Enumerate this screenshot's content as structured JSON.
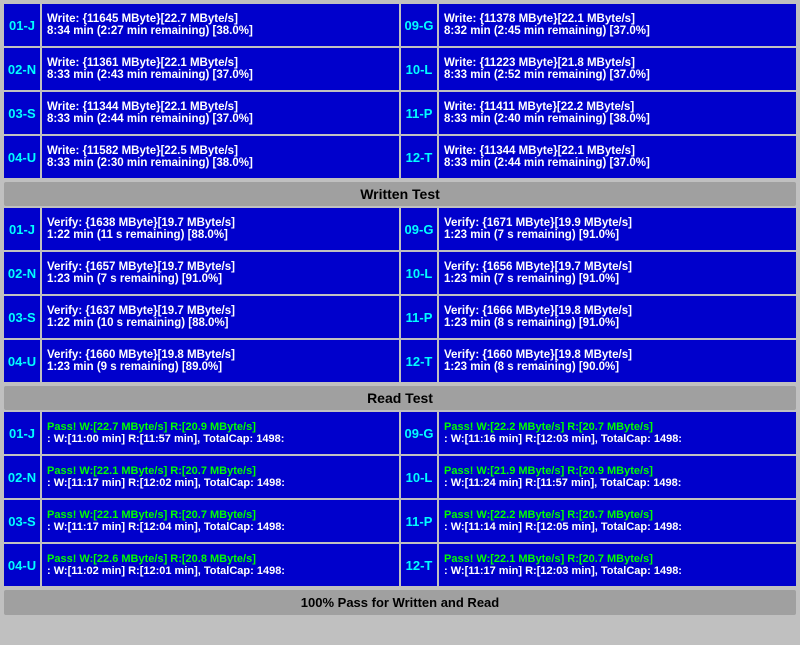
{
  "sections": {
    "write": {
      "label": "Written Test",
      "rows": [
        {
          "left": {
            "id": "01-J",
            "line1": "Write: {11645 MByte}[22.7 MByte/s]",
            "line2": "8:34 min (2:27 min remaining)  [38.0%]"
          },
          "right": {
            "id": "09-G",
            "line1": "Write: {11378 MByte}[22.1 MByte/s]",
            "line2": "8:32 min (2:45 min remaining)  [37.0%]"
          }
        },
        {
          "left": {
            "id": "02-N",
            "line1": "Write: {11361 MByte}[22.1 MByte/s]",
            "line2": "8:33 min (2:43 min remaining)  [37.0%]"
          },
          "right": {
            "id": "10-L",
            "line1": "Write: {11223 MByte}[21.8 MByte/s]",
            "line2": "8:33 min (2:52 min remaining)  [37.0%]"
          }
        },
        {
          "left": {
            "id": "03-S",
            "line1": "Write: {11344 MByte}[22.1 MByte/s]",
            "line2": "8:33 min (2:44 min remaining)  [37.0%]"
          },
          "right": {
            "id": "11-P",
            "line1": "Write: {11411 MByte}[22.2 MByte/s]",
            "line2": "8:33 min (2:40 min remaining)  [38.0%]"
          }
        },
        {
          "left": {
            "id": "04-U",
            "line1": "Write: {11582 MByte}[22.5 MByte/s]",
            "line2": "8:33 min (2:30 min remaining)  [38.0%]"
          },
          "right": {
            "id": "12-T",
            "line1": "Write: {11344 MByte}[22.1 MByte/s]",
            "line2": "8:33 min (2:44 min remaining)  [37.0%]"
          }
        }
      ]
    },
    "verify": {
      "label": "Written Test",
      "rows": [
        {
          "left": {
            "id": "01-J",
            "line1": "Verify: {1638 MByte}[19.7 MByte/s]",
            "line2": "1:22 min (11 s remaining)   [88.0%]"
          },
          "right": {
            "id": "09-G",
            "line1": "Verify: {1671 MByte}[19.9 MByte/s]",
            "line2": "1:23 min (7 s remaining)   [91.0%]"
          }
        },
        {
          "left": {
            "id": "02-N",
            "line1": "Verify: {1657 MByte}[19.7 MByte/s]",
            "line2": "1:23 min (7 s remaining)   [91.0%]"
          },
          "right": {
            "id": "10-L",
            "line1": "Verify: {1656 MByte}[19.7 MByte/s]",
            "line2": "1:23 min (7 s remaining)   [91.0%]"
          }
        },
        {
          "left": {
            "id": "03-S",
            "line1": "Verify: {1637 MByte}[19.7 MByte/s]",
            "line2": "1:22 min (10 s remaining)   [88.0%]"
          },
          "right": {
            "id": "11-P",
            "line1": "Verify: {1666 MByte}[19.8 MByte/s]",
            "line2": "1:23 min (8 s remaining)   [91.0%]"
          }
        },
        {
          "left": {
            "id": "04-U",
            "line1": "Verify: {1660 MByte}[19.8 MByte/s]",
            "line2": "1:23 min (9 s remaining)   [89.0%]"
          },
          "right": {
            "id": "12-T",
            "line1": "Verify: {1660 MByte}[19.8 MByte/s]",
            "line2": "1:23 min (8 s remaining)   [90.0%]"
          }
        }
      ]
    },
    "read": {
      "label": "Read Test",
      "rows": [
        {
          "left": {
            "id": "01-J",
            "line1": "Pass! W:[22.7 MByte/s] R:[20.9 MByte/s]",
            "line2": ": W:[11:00 min] R:[11:57 min], TotalCap: 1498:"
          },
          "right": {
            "id": "09-G",
            "line1": "Pass! W:[22.2 MByte/s] R:[20.7 MByte/s]",
            "line2": ": W:[11:16 min] R:[12:03 min], TotalCap: 1498:"
          }
        },
        {
          "left": {
            "id": "02-N",
            "line1": "Pass! W:[22.1 MByte/s] R:[20.7 MByte/s]",
            "line2": ": W:[11:17 min] R:[12:02 min], TotalCap: 1498:"
          },
          "right": {
            "id": "10-L",
            "line1": "Pass! W:[21.9 MByte/s] R:[20.9 MByte/s]",
            "line2": ": W:[11:24 min] R:[11:57 min], TotalCap: 1498:"
          }
        },
        {
          "left": {
            "id": "03-S",
            "line1": "Pass! W:[22.1 MByte/s] R:[20.7 MByte/s]",
            "line2": ": W:[11:17 min] R:[12:04 min], TotalCap: 1498:"
          },
          "right": {
            "id": "11-P",
            "line1": "Pass! W:[22.2 MByte/s] R:[20.7 MByte/s]",
            "line2": ": W:[11:14 min] R:[12:05 min], TotalCap: 1498:"
          }
        },
        {
          "left": {
            "id": "04-U",
            "line1": "Pass! W:[22.6 MByte/s] R:[20.8 MByte/s]",
            "line2": ": W:[11:02 min] R:[12:01 min], TotalCap: 1498:"
          },
          "right": {
            "id": "12-T",
            "line1": "Pass! W:[22.1 MByte/s] R:[20.7 MByte/s]",
            "line2": ": W:[11:17 min] R:[12:03 min], TotalCap: 1498:"
          }
        }
      ]
    }
  },
  "headers": {
    "written_test": "Written Test",
    "read_test": "Read Test"
  },
  "footer": "100% Pass for Written and Read"
}
